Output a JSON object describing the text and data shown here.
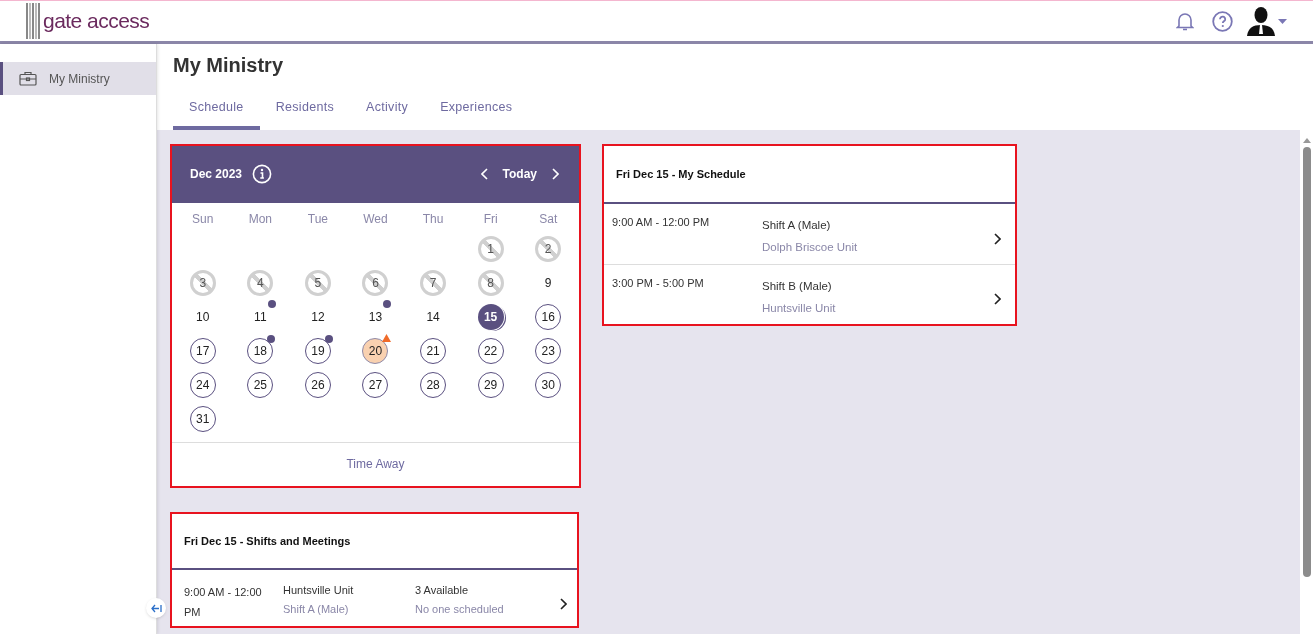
{
  "app": {
    "logo_text": "gate access"
  },
  "sidebar": {
    "items": [
      {
        "label": "My Ministry",
        "selected": true
      }
    ]
  },
  "page": {
    "title": "My Ministry"
  },
  "tabs": [
    {
      "label": "Schedule",
      "selected": true
    },
    {
      "label": "Residents",
      "selected": false
    },
    {
      "label": "Activity",
      "selected": false
    },
    {
      "label": "Experiences",
      "selected": false
    }
  ],
  "calendar": {
    "highlighted": true,
    "month": "Dec 2023",
    "today_button": "Today",
    "weekdays": [
      "Sun",
      "Mon",
      "Tue",
      "Wed",
      "Thu",
      "Fri",
      "Sat"
    ],
    "days": [
      {
        "label": "1",
        "kind": "unavailable",
        "dot": false
      },
      {
        "label": "2",
        "kind": "unavailable",
        "dot": false
      },
      {
        "label": "3",
        "kind": "unavailable",
        "dot": false
      },
      {
        "label": "4",
        "kind": "unavailable",
        "dot": false
      },
      {
        "label": "5",
        "kind": "unavailable",
        "dot": false
      },
      {
        "label": "6",
        "kind": "unavailable",
        "dot": false
      },
      {
        "label": "7",
        "kind": "unavailable",
        "dot": false
      },
      {
        "label": "8",
        "kind": "unavailable",
        "dot": false
      },
      {
        "label": "9",
        "kind": "plain",
        "dot": false
      },
      {
        "label": "10",
        "kind": "plain",
        "dot": false
      },
      {
        "label": "11",
        "kind": "plain",
        "dot": true
      },
      {
        "label": "12",
        "kind": "plain",
        "dot": false
      },
      {
        "label": "13",
        "kind": "plain",
        "dot": true
      },
      {
        "label": "14",
        "kind": "plain",
        "dot": false
      },
      {
        "label": "15",
        "kind": "selected",
        "dot": false
      },
      {
        "label": "16",
        "kind": "open",
        "dot": false
      },
      {
        "label": "17",
        "kind": "open",
        "dot": false
      },
      {
        "label": "18",
        "kind": "open",
        "dot": true
      },
      {
        "label": "19",
        "kind": "open",
        "dot": true
      },
      {
        "label": "20",
        "kind": "warning",
        "dot": false
      },
      {
        "label": "21",
        "kind": "open",
        "dot": false
      },
      {
        "label": "22",
        "kind": "open",
        "dot": false
      },
      {
        "label": "23",
        "kind": "open",
        "dot": false
      },
      {
        "label": "24",
        "kind": "open",
        "dot": false
      },
      {
        "label": "25",
        "kind": "open",
        "dot": false
      },
      {
        "label": "26",
        "kind": "open",
        "dot": false
      },
      {
        "label": "27",
        "kind": "open",
        "dot": false
      },
      {
        "label": "28",
        "kind": "open",
        "dot": false
      },
      {
        "label": "29",
        "kind": "open",
        "dot": false
      },
      {
        "label": "30",
        "kind": "open",
        "dot": false
      },
      {
        "label": "31",
        "kind": "open",
        "dot": false
      }
    ],
    "footer_link": "Time Away"
  },
  "my_schedule": {
    "highlighted": true,
    "title": "Fri Dec 15 - My Schedule",
    "rows": [
      {
        "time": "9:00 AM - 12:00 PM",
        "shift": "Shift A (Male)",
        "unit": "Dolph Briscoe Unit"
      },
      {
        "time": "3:00 PM - 5:00 PM",
        "shift": "Shift B (Male)",
        "unit": "Huntsville Unit"
      }
    ]
  },
  "shifts_meetings": {
    "highlighted": true,
    "title": "Fri Dec 15 - Shifts and Meetings",
    "rows": [
      {
        "time": "9:00 AM - 12:00 PM",
        "unit": "Huntsville Unit",
        "shift": "Shift A (Male)",
        "availability": "3 Available",
        "scheduled": "No one scheduled"
      }
    ]
  }
}
